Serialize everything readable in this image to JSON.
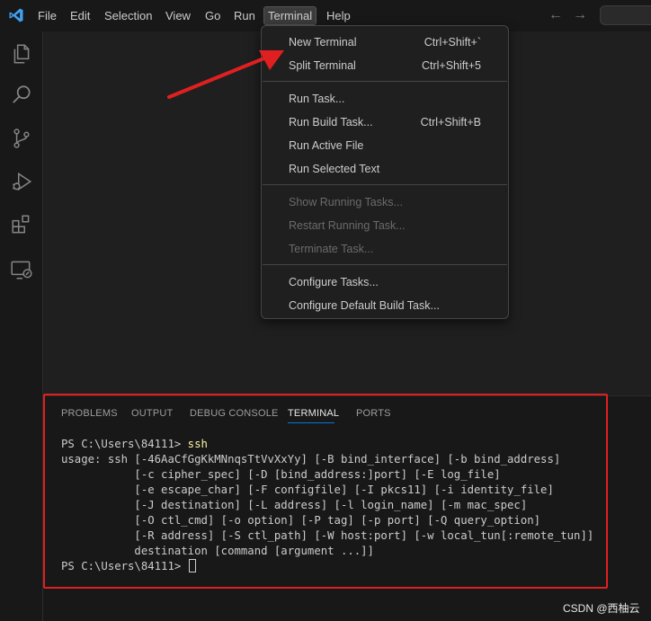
{
  "titlebar": {
    "menus": [
      "File",
      "Edit",
      "Selection",
      "View",
      "Go",
      "Run",
      "Terminal",
      "Help"
    ],
    "active_menu": "Terminal"
  },
  "activitybar": {
    "icons": [
      "explorer-icon",
      "search-icon",
      "source-control-icon",
      "run-debug-icon",
      "extensions-icon",
      "remote-explorer-icon"
    ]
  },
  "terminal_menu": {
    "groups": [
      [
        {
          "label": "New Terminal",
          "shortcut": "Ctrl+Shift+`"
        },
        {
          "label": "Split Terminal",
          "shortcut": "Ctrl+Shift+5"
        }
      ],
      [
        {
          "label": "Run Task...",
          "shortcut": ""
        },
        {
          "label": "Run Build Task...",
          "shortcut": "Ctrl+Shift+B"
        },
        {
          "label": "Run Active File",
          "shortcut": ""
        },
        {
          "label": "Run Selected Text",
          "shortcut": ""
        }
      ],
      [
        {
          "label": "Show Running Tasks...",
          "shortcut": "",
          "disabled": true
        },
        {
          "label": "Restart Running Task...",
          "shortcut": "",
          "disabled": true
        },
        {
          "label": "Terminate Task...",
          "shortcut": "",
          "disabled": true
        }
      ],
      [
        {
          "label": "Configure Tasks...",
          "shortcut": ""
        },
        {
          "label": "Configure Default Build Task...",
          "shortcut": ""
        }
      ]
    ]
  },
  "panel": {
    "tabs": [
      "PROBLEMS",
      "OUTPUT",
      "DEBUG CONSOLE",
      "TERMINAL",
      "PORTS"
    ],
    "active_tab": "TERMINAL"
  },
  "terminal": {
    "prompt1": "PS C:\\Users\\84111> ",
    "command1": "ssh",
    "output": [
      "usage: ssh [-46AaCfGgKkMNnqsTtVvXxYy] [-B bind_interface] [-b bind_address]",
      "           [-c cipher_spec] [-D [bind_address:]port] [-E log_file]",
      "           [-e escape_char] [-F configfile] [-I pkcs11] [-i identity_file]",
      "           [-J destination] [-L address] [-l login_name] [-m mac_spec]",
      "           [-O ctl_cmd] [-o option] [-P tag] [-p port] [-Q query_option]",
      "           [-R address] [-S ctl_path] [-W host:port] [-w local_tun[:remote_tun]]",
      "           destination [command [argument ...]]"
    ],
    "prompt2": "PS C:\\Users\\84111> "
  },
  "watermark": "CSDN @西柚云",
  "colors": {
    "accent": "#0078d4",
    "highlight": "#e02020",
    "command": "#f9f1a5"
  }
}
